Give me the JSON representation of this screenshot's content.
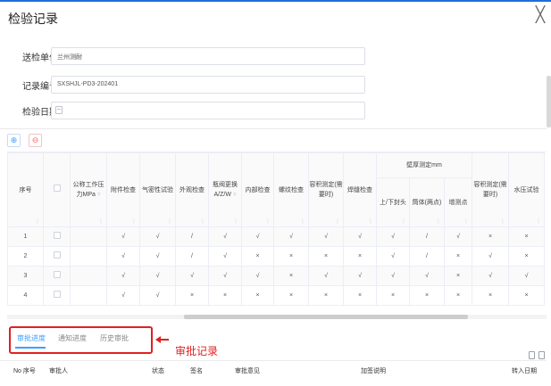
{
  "dialog": {
    "title": "检验记录",
    "close_glyph": "╳"
  },
  "form": {
    "unit": {
      "label": "送检单位",
      "value": "兰州测耐"
    },
    "record_no": {
      "label": "记录编号",
      "value": "SXSHJL-PD3-202401"
    },
    "inspect_date": {
      "label": "检验日期",
      "value": ""
    }
  },
  "table_controls": {
    "add_glyph": "⊕",
    "delete_glyph": "⊖"
  },
  "table": {
    "headers": {
      "seq": "序号",
      "pressure": "公称工作压力MPa",
      "attachment": "附件检查",
      "airtight": "气密性试验",
      "appearance": "外观检查",
      "valve": "瓶阀更换A/Z/W",
      "internal": "内部检查",
      "thread": "螺纹检查",
      "volume1": "容积测定(需要时)",
      "weld": "焊缝检查",
      "thickness_group": "壁厚测定mm",
      "upper_lower": "上/下封头",
      "body": "筒体(两点)",
      "add_point": "增测点",
      "volume2": "容积测定(需要时)",
      "pressure_test": "水压试验"
    },
    "rows": [
      {
        "seq": "1",
        "pressure": "",
        "attachment": "√",
        "airtight": "√",
        "appearance": "/",
        "valve": "√",
        "internal": "√",
        "thread": "√",
        "volume1": "√",
        "weld": "√",
        "upper_lower": "√",
        "body": "/",
        "add_point": "√",
        "volume2": "×",
        "pressure_test": "×"
      },
      {
        "seq": "2",
        "pressure": "",
        "attachment": "√",
        "airtight": "√",
        "appearance": "/",
        "valve": "√",
        "internal": "×",
        "thread": "×",
        "volume1": "×",
        "weld": "×",
        "upper_lower": "√",
        "body": "/",
        "add_point": "×",
        "volume2": "√",
        "pressure_test": "×"
      },
      {
        "seq": "3",
        "pressure": "",
        "attachment": "√",
        "airtight": "√",
        "appearance": "√",
        "valve": "√",
        "internal": "√",
        "thread": "×",
        "volume1": "√",
        "weld": "√",
        "upper_lower": "√",
        "body": "√",
        "add_point": "×",
        "volume2": "√",
        "pressure_test": "√"
      },
      {
        "seq": "4",
        "pressure": "",
        "attachment": "√",
        "airtight": "√",
        "appearance": "×",
        "valve": "×",
        "internal": "×",
        "thread": "×",
        "volume1": "×",
        "weld": "×",
        "upper_lower": "×",
        "body": "×",
        "add_point": "×",
        "volume2": "×",
        "pressure_test": "×"
      }
    ]
  },
  "tabs": [
    {
      "label": "审批进度",
      "active": true
    },
    {
      "label": "通知进度",
      "active": false
    },
    {
      "label": "历史审批",
      "active": false
    }
  ],
  "annotation": {
    "text": "审批记录"
  },
  "approval_table": {
    "headers": {
      "no": "No 序号",
      "approver": "审批人",
      "status": "状态",
      "signature": "签名",
      "opinion": "审批意见",
      "note": "加签说明",
      "date": "转入日期"
    }
  },
  "colors": {
    "accent": "#409eff",
    "annotation_red": "#e02020",
    "top_bar": "#1e6fd8"
  }
}
